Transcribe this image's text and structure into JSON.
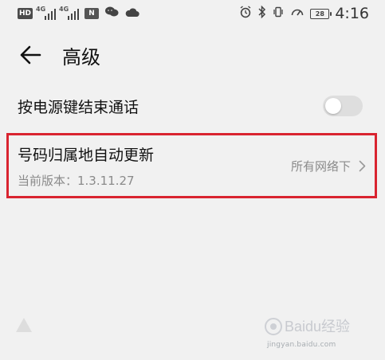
{
  "status_bar": {
    "network_badge": "HD",
    "signal_1_tag": "4G",
    "signal_2_tag": "4G",
    "nfc_icon": "N",
    "time": "4:16",
    "battery": "28"
  },
  "header": {
    "title": "高级"
  },
  "settings": {
    "power_end_call": {
      "label": "按电源键结束通话",
      "enabled": false
    },
    "number_location_update": {
      "label": "号码归属地自动更新",
      "version": "当前版本：1.3.11.27",
      "value": "所有网络下"
    }
  },
  "watermark": {
    "logo": "Baidu经验",
    "url": "jingyan.baidu.com"
  },
  "colors": {
    "background": "#f1f1f1",
    "highlight": "#d92430",
    "secondary_text": "#8a8a8a"
  },
  "icons": {
    "back": "arrow-left-icon",
    "chevron": "chevron-right-icon",
    "bluetooth": "bluetooth-icon",
    "alarm": "alarm-icon"
  }
}
